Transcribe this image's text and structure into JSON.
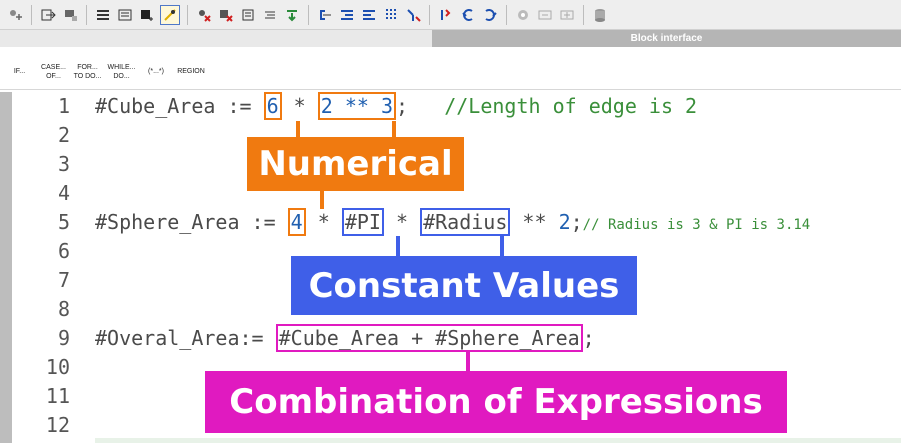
{
  "toolbar": {
    "icons": [
      "insert-icon",
      "goto-icon",
      "monitor-icon",
      "list-icon",
      "call-icon",
      "bookmark-icon",
      "breakpoint-set-icon",
      "breakpoint-remove-icon",
      "breakpoint-clear-icon",
      "comment-icon",
      "format-icon",
      "download-icon",
      "indent-icon",
      "outdent-icon",
      "align-icon",
      "toggle-icon",
      "step-icon",
      "run-icon",
      "back-icon",
      "forward-icon",
      "watch-icon",
      "cycle-icon",
      "hide-icon",
      "db-icon"
    ]
  },
  "block_interface": {
    "label": "Block interface"
  },
  "keywords": [
    {
      "label": "IF..."
    },
    {
      "label": "CASE...\nOF..."
    },
    {
      "label": "FOR...\nTO DO..."
    },
    {
      "label": "WHILE...\nDO..."
    },
    {
      "label": "(*...*)"
    },
    {
      "label": "REGION"
    }
  ],
  "lines": {
    "numbers": [
      "1",
      "2",
      "3",
      "4",
      "5",
      "6",
      "7",
      "8",
      "9",
      "10",
      "11",
      "12"
    ],
    "l1": {
      "var": "#Cube_Area",
      "assign": " := ",
      "n1": "6",
      "op1": " * ",
      "n2": "2",
      "op2": " ** ",
      "n3": "3",
      "end": ";",
      "comment": "   //Length of edge is 2"
    },
    "l5": {
      "var": "#Sphere_Area",
      "assign": " := ",
      "n1": "4",
      "op1": " * ",
      "c1": "#PI",
      "op2": " * ",
      "c2": "#Radius",
      "op3": " ** ",
      "n2": "2",
      "end": ";",
      "comment": "// Radius is 3 & PI is 3.14"
    },
    "l9": {
      "var": "#Overal_Area",
      "assign": ":= ",
      "expr_a": "#Cube_Area",
      "plus": " + ",
      "expr_b": "#Sphere_Area",
      "end": ";"
    }
  },
  "annotations": {
    "numerical": "Numerical",
    "constant": "Constant Values",
    "combination": "Combination of Expressions"
  },
  "colors": {
    "orange": "#f07a10",
    "blue": "#3f5fe8",
    "magenta": "#e01ac0",
    "number": "#1f5fb0",
    "comment": "#3a8f3a"
  }
}
